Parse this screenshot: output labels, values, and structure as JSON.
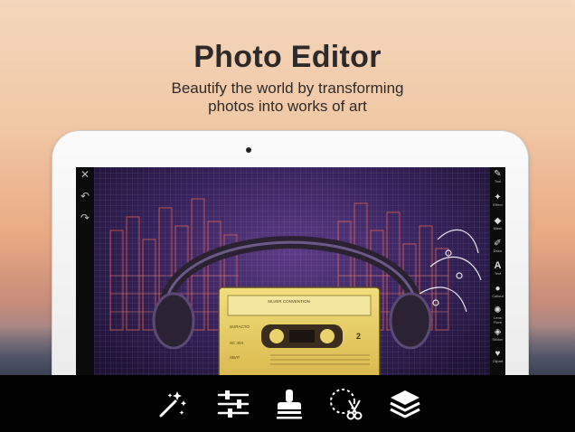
{
  "header": {
    "title": "Photo Editor",
    "subtitle_line1": "Beautify the world by transforming",
    "subtitle_line2": "photos into works of art"
  },
  "editor": {
    "left_toolbar": [
      {
        "icon": "close-icon",
        "glyph": "✕"
      },
      {
        "icon": "undo-icon",
        "glyph": "↶"
      },
      {
        "icon": "redo-icon",
        "glyph": "↷"
      }
    ],
    "right_toolbar": [
      {
        "icon": "tool-icon",
        "glyph": "✎",
        "label": "Tool"
      },
      {
        "icon": "effect-icon",
        "glyph": "✦",
        "label": "Effect"
      },
      {
        "icon": "mask-icon",
        "glyph": "◆",
        "label": "Mask"
      },
      {
        "icon": "draw-icon",
        "glyph": "✐",
        "label": "Draw"
      },
      {
        "icon": "text-icon",
        "glyph": "A",
        "label": "Text"
      },
      {
        "icon": "callout-icon",
        "glyph": "●",
        "label": "Callout"
      },
      {
        "icon": "lens-flare-icon",
        "glyph": "✺",
        "label": "Lens Flare"
      },
      {
        "icon": "sticker-icon",
        "glyph": "◈",
        "label": "Sticker"
      },
      {
        "icon": "clipart-icon",
        "glyph": "♥",
        "label": "Clipart"
      }
    ],
    "cassette": {
      "label_title": "SILVER CONVENTION",
      "side_number": "2",
      "brand": "SURACTO",
      "serial": "SC 404",
      "bottom_code": "SBAT"
    }
  },
  "bottom_toolbar": [
    {
      "icon": "magic-wand-icon"
    },
    {
      "icon": "sliders-icon"
    },
    {
      "icon": "stamp-icon"
    },
    {
      "icon": "cutout-scissors-icon"
    },
    {
      "icon": "layers-icon"
    }
  ],
  "colors": {
    "title_text": "#2f2a2a",
    "cassette_yellow": "#e9d36a",
    "canvas_purple": "#3a2460"
  }
}
